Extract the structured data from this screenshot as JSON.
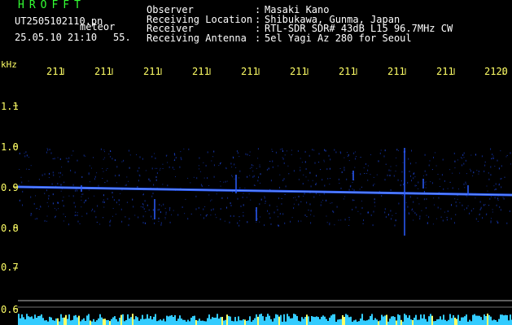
{
  "header": {
    "logo": "HROFFT",
    "filename": "UT2505102110.pn",
    "filename_suffix": "meteor",
    "datetime": "25.05.10 21:10",
    "count": "55."
  },
  "info": {
    "rows": [
      {
        "label": "Observer",
        "sep": ":",
        "value": "Masaki Kano"
      },
      {
        "label": "Receiving Location",
        "sep": ":",
        "value": "Shibukawa, Gunma, Japan"
      },
      {
        "label": "Receiver",
        "sep": ":",
        "value": "RTL-SDR SDR# 43dB L15 96.7MHz CW"
      },
      {
        "label": "Receiving Antenna",
        "sep": ":",
        "value": "5el Yagi Az 280 for Seoul"
      }
    ]
  },
  "axes": {
    "y_unit": "kHz",
    "y_ticks": [
      "1.1",
      "1.0",
      "0.9",
      "0.8",
      "0.7",
      "0.6"
    ],
    "x_ticks": [
      "211",
      "211",
      "211",
      "211",
      "211",
      "211",
      "211",
      "211",
      "211",
      "2120"
    ]
  },
  "colors": {
    "text_label": "#ffffff",
    "text_value": "#ffff66",
    "logo": "#33ff33",
    "signal": "#2a5cff",
    "noise": "#102a8a",
    "activity_bar": "#33ccff"
  },
  "chart_data": {
    "type": "heatmap",
    "y_unit": "kHz",
    "ylim": [
      0.6,
      1.15
    ],
    "signal_start_khz": 0.9,
    "signal_end_khz": 0.88
  }
}
